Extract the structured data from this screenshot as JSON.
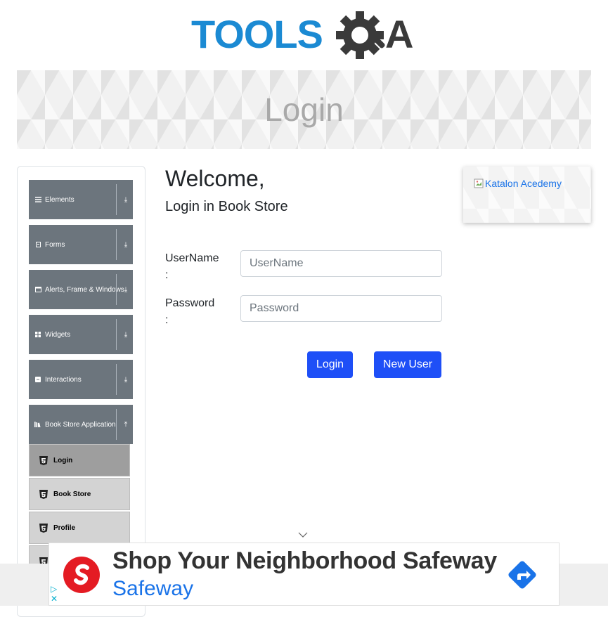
{
  "logo": {
    "text_left": "TOOLS",
    "text_right": "A",
    "alt": "ToolsQA logo"
  },
  "banner": {
    "title": "Login"
  },
  "sidebar": {
    "groups": [
      {
        "label": "Elements",
        "icon": "hamburger-icon",
        "arrow": "⤓"
      },
      {
        "label": "Forms",
        "icon": "form-icon",
        "arrow": "⤓"
      },
      {
        "label": "Alerts, Frame & Windows",
        "icon": "window-icon",
        "arrow": "⤓"
      },
      {
        "label": "Widgets",
        "icon": "grid-icon",
        "arrow": "⤓"
      },
      {
        "label": "Interactions",
        "icon": "interaction-icon",
        "arrow": "⤓"
      },
      {
        "label": "Book Store Application",
        "icon": "books-icon",
        "arrow": "⤒"
      }
    ],
    "items": [
      {
        "label": "Login",
        "active": true
      },
      {
        "label": "Book Store",
        "active": false
      },
      {
        "label": "Profile",
        "active": false
      }
    ]
  },
  "main": {
    "welcome": "Welcome,",
    "subtitle": "Login in Book Store",
    "username_label": "UserName",
    "username_colon": ":",
    "username_placeholder": "UserName",
    "username_value": "",
    "password_label": "Password",
    "password_colon": ":",
    "password_placeholder": "Password",
    "password_value": "",
    "login_button": "Login",
    "new_user_button": "New User"
  },
  "side_ad": {
    "alt_text": "Katalon Acedemy"
  },
  "bottom_ad": {
    "headline": "Shop Your Neighborhood Safeway",
    "brand": "Safeway",
    "adchoices": "▷",
    "close": "✕"
  },
  "colors": {
    "primary_button": "#1e4ff7",
    "sidebar_group": "#6c757d",
    "sidebar_item": "#d3d3d3",
    "sidebar_item_active": "#9e9e9e",
    "logo_blue": "#1b8ad3",
    "ad_red": "#e41b23",
    "ad_blue": "#1a73e8"
  }
}
